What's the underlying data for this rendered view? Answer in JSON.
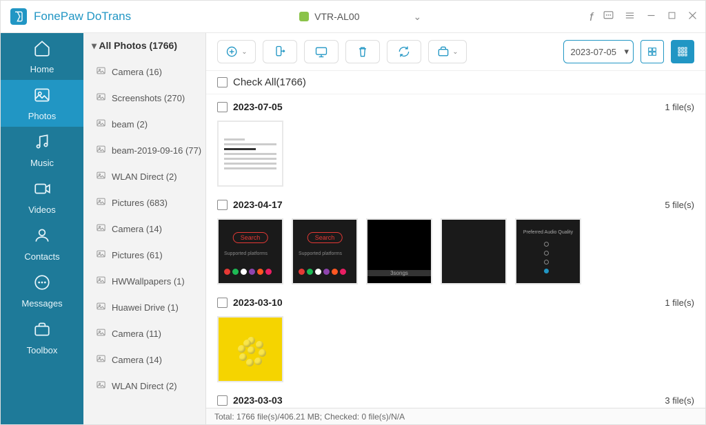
{
  "app": {
    "brand": "FonePaw DoTrans",
    "device": "VTR-AL00"
  },
  "nav": {
    "items": [
      {
        "key": "home",
        "label": "Home"
      },
      {
        "key": "photos",
        "label": "Photos"
      },
      {
        "key": "music",
        "label": "Music"
      },
      {
        "key": "videos",
        "label": "Videos"
      },
      {
        "key": "contacts",
        "label": "Contacts"
      },
      {
        "key": "messages",
        "label": "Messages"
      },
      {
        "key": "toolbox",
        "label": "Toolbox"
      }
    ],
    "active": "photos"
  },
  "folders": {
    "heading": "All Photos (1766)",
    "items": [
      {
        "label": "Camera (16)"
      },
      {
        "label": "Screenshots (270)"
      },
      {
        "label": "beam (2)"
      },
      {
        "label": "beam-2019-09-16 (77)"
      },
      {
        "label": "WLAN Direct (2)"
      },
      {
        "label": "Pictures (683)"
      },
      {
        "label": "Camera (14)"
      },
      {
        "label": "Pictures (61)"
      },
      {
        "label": "HWWallpapers (1)"
      },
      {
        "label": "Huawei Drive (1)"
      },
      {
        "label": "Camera (11)"
      },
      {
        "label": "Camera (14)"
      },
      {
        "label": "WLAN Direct (2)"
      }
    ]
  },
  "toolbar": {
    "date_filter": "2023-07-05"
  },
  "checkall": {
    "label": "Check All(1766)"
  },
  "groups": [
    {
      "date": "2023-07-05",
      "count": "1 file(s)",
      "thumbs": [
        "textdoc"
      ]
    },
    {
      "date": "2023-04-17",
      "count": "5 file(s)",
      "thumbs": [
        "dark",
        "dark",
        "gallery",
        "darktext",
        "radios"
      ]
    },
    {
      "date": "2023-03-10",
      "count": "1 file(s)",
      "thumbs": [
        "flower"
      ]
    },
    {
      "date": "2023-03-03",
      "count": "3 file(s)",
      "thumbs": []
    }
  ],
  "status": "Total: 1766 file(s)/406.21 MB; Checked: 0 file(s)/N/A"
}
